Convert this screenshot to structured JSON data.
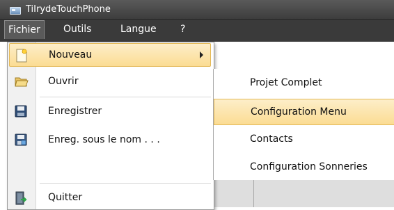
{
  "window": {
    "title": "TiIrydeTouchPhone",
    "icon": "app-window-icon"
  },
  "menubar": {
    "items": [
      {
        "label": "Fichier",
        "open": true
      },
      {
        "label": "Outils"
      },
      {
        "label": "Langue"
      },
      {
        "label": "?"
      }
    ]
  },
  "file_menu": {
    "items": [
      {
        "label": "Nouveau",
        "icon": "new-document-icon",
        "has_submenu": true,
        "highlighted": true
      },
      {
        "label": "Ouvrir",
        "icon": "open-folder-icon"
      },
      {
        "label": "Enregistrer",
        "icon": "save-disk-icon"
      },
      {
        "label": "Enreg. sous le nom . . .",
        "icon": "save-as-icon"
      },
      {
        "label": "Quitter",
        "icon": "exit-door-icon"
      }
    ]
  },
  "submenu": {
    "items": [
      {
        "label": "Projet Complet"
      },
      {
        "label": "Configuration Menu",
        "highlighted": true
      },
      {
        "label": "Contacts"
      },
      {
        "label": "Configuration Sonneries"
      }
    ]
  },
  "colors": {
    "titlebar": "#3c3c3c",
    "menubar": "#3a3a3a",
    "highlight": "#fbdc93",
    "highlight_border": "#e3b855"
  }
}
